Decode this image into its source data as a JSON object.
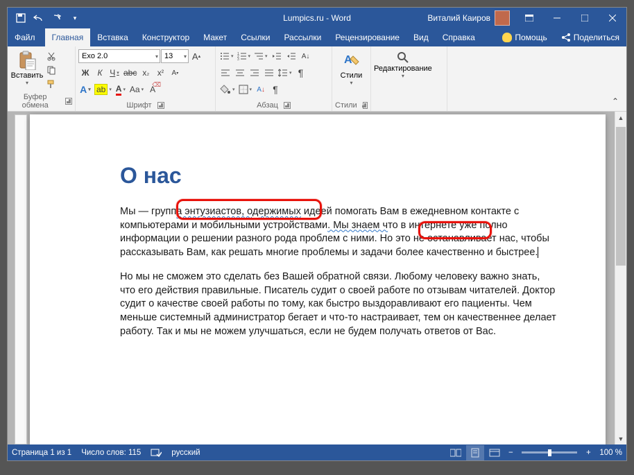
{
  "titlebar": {
    "title": "Lumpics.ru - Word",
    "user_name": "Виталий Каиров"
  },
  "tabs": {
    "file": "Файл",
    "items": [
      "Главная",
      "Вставка",
      "Конструктор",
      "Макет",
      "Ссылки",
      "Рассылки",
      "Рецензирование",
      "Вид",
      "Справка"
    ],
    "help": "Помощь",
    "share": "Поделиться"
  },
  "ribbon": {
    "clipboard": {
      "label": "Буфер обмена",
      "paste": "Вставить"
    },
    "font": {
      "label": "Шрифт",
      "name": "Exo 2.0",
      "size": "13"
    },
    "paragraph": {
      "label": "Абзац"
    },
    "styles": {
      "label": "Стили",
      "btn": "Стили"
    },
    "editing": {
      "label": "Редактирование"
    }
  },
  "document": {
    "heading": "О нас",
    "p1_a": "Мы — групп",
    "p1_hl": "а энтузиастов, одержимых",
    "p1_b": " идеей помогать Вам в ежедневном контакте с компьютерами и мобильными устройствами",
    "p1_hl2": ". Мы знаем ч",
    "p1_c": "то в интернете уже полно информации о решении разного рода проблем с ними. Но это не останавливает нас, чтобы рассказывать Вам, как решать многие проблемы и задачи более качественно и быстрее.",
    "p2": "Но мы не сможем это сделать без Вашей обратной связи. Любому человеку важно знать, что его действия правильные. Писатель судит о своей работе по отзывам читателей. Доктор судит о качестве своей работы по тому, как быстро выздоравливают его пациенты. Чем меньше системный администратор бегает и что-то настраивает, тем он качественнее делает работу. Так и мы не можем улучшаться, если не будем получать ответов от Вас."
  },
  "status": {
    "page": "Страница 1 из 1",
    "words": "Число слов: 115",
    "lang": "русский",
    "zoom": "100 %"
  }
}
